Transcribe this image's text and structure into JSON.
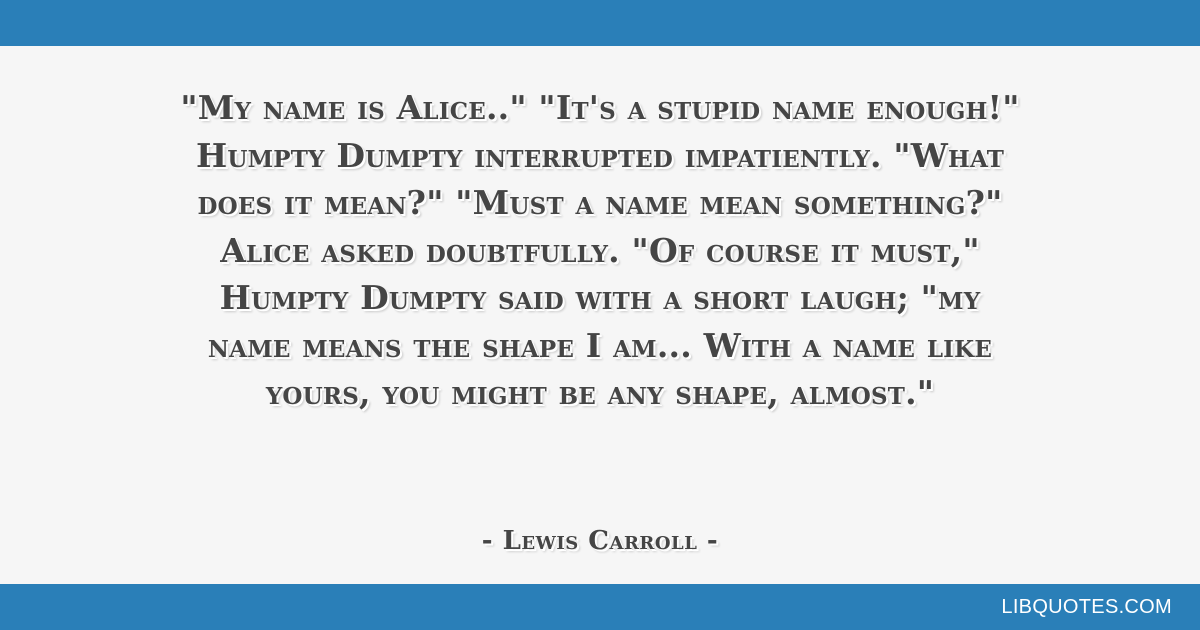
{
  "quote": {
    "lines": [
      "\"My name is Alice..\" \"It's a stupid name enough!\"",
      "Humpty Dumpty interrupted impatiently. \"What",
      "does it mean?\" \"Must a name mean something?\"",
      "Alice asked doubtfully. \"Of course it must,\"",
      "Humpty Dumpty said with a short laugh; \"my",
      "name means the shape I am... With a name like",
      "yours, you might be any shape, almost.\""
    ]
  },
  "author": "- Lewis Carroll -",
  "footer": {
    "brand": "LIBQUOTES.COM"
  },
  "colors": {
    "bar": "#2a7fb8",
    "background": "#f6f6f6",
    "text": "#454545",
    "brand_text": "#ffffff"
  }
}
